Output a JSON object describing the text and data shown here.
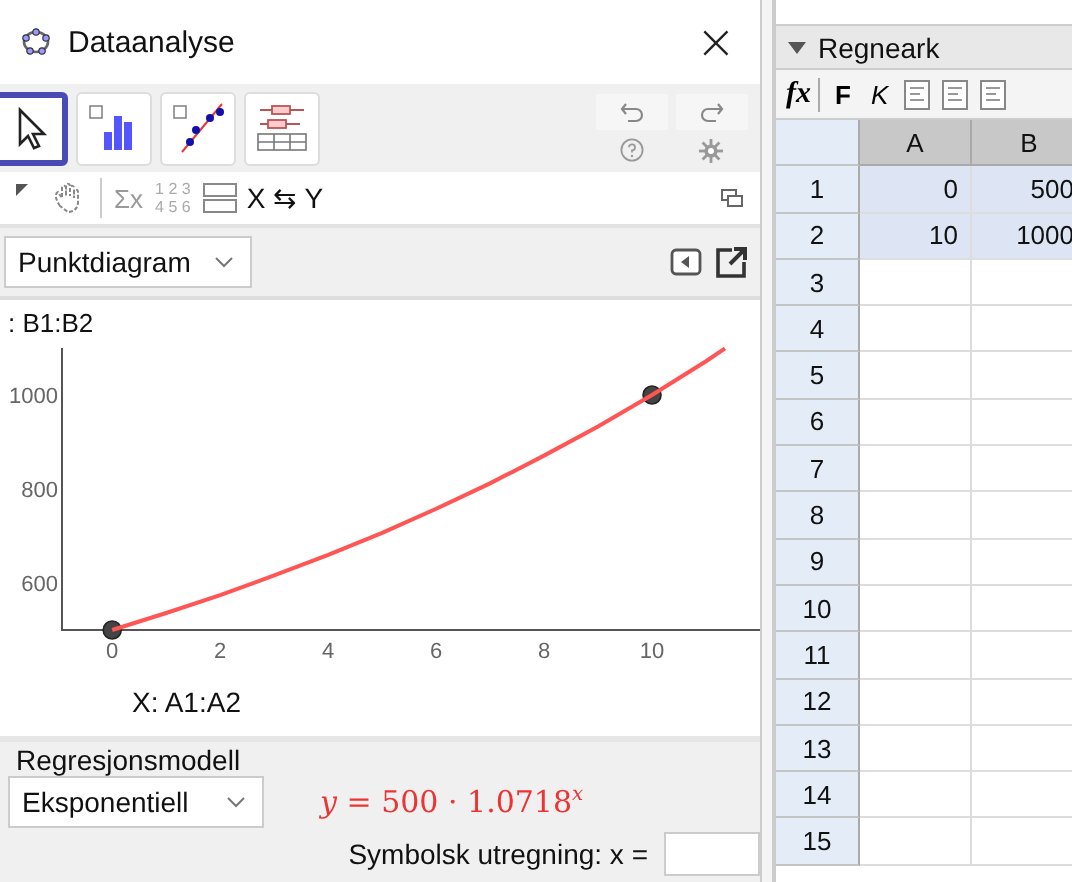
{
  "window": {
    "title": "Dataanalyse",
    "close": "×"
  },
  "tools": [
    {
      "kind": "pointer",
      "selected": true
    },
    {
      "kind": "histogram",
      "selected": false
    },
    {
      "kind": "scatter",
      "selected": false
    },
    {
      "kind": "boxplot",
      "selected": false
    }
  ],
  "swap_label": "X ⇆ Y",
  "sum_label": "Σx",
  "table_digits": [
    "1 2 3",
    "4 5 6"
  ],
  "plot_type": "Punktdiagram",
  "y_source": ":  B1:B2",
  "x_source": "X:  A1:A2",
  "chart_data": {
    "type": "scatter",
    "x": [
      0,
      1,
      2,
      3,
      4,
      5,
      6,
      7,
      8,
      9,
      10,
      11,
      11.35
    ],
    "series": [
      {
        "type": "scatter",
        "color": "#444444",
        "values": [
          500,
          null,
          null,
          null,
          null,
          null,
          null,
          null,
          null,
          null,
          1000,
          null,
          null
        ]
      },
      {
        "type": "line",
        "color": "#ff5555",
        "values": [
          500,
          536,
          574,
          616,
          660,
          707,
          758,
          812,
          871,
          933,
          1000,
          1072,
          1099
        ]
      }
    ],
    "xlim": [
      -0.93,
      12
    ],
    "ylim": [
      500,
      1100
    ],
    "xticks": [
      0,
      2,
      4,
      6,
      8,
      10
    ],
    "yticks": [
      600,
      800,
      1000
    ]
  },
  "regression": {
    "title": "Regresjonsmodell",
    "model": "Eksponentiell",
    "formula": "*y* = 500 · 1.0718$^{x}$",
    "symbolic_label": "Symbolsk utregning:  x ="
  },
  "sheet": {
    "title": "Regneark",
    "fx": "fx",
    "bold": "F",
    "italic": "K",
    "columns": [
      "A",
      "B"
    ],
    "rows": [
      {
        "label": "1",
        "cells": [
          "0",
          "500"
        ],
        "selected": true
      },
      {
        "label": "2",
        "cells": [
          "10",
          "1000"
        ],
        "selected": true
      },
      {
        "label": "3",
        "selected": false
      },
      {
        "label": "4",
        "selected": false
      },
      {
        "label": "5",
        "selected": false
      },
      {
        "label": "6",
        "selected": false
      },
      {
        "label": "7",
        "selected": false
      },
      {
        "label": "8",
        "selected": false
      },
      {
        "label": "9",
        "selected": false
      },
      {
        "label": "10",
        "selected": false
      },
      {
        "label": "11",
        "selected": false
      },
      {
        "label": "12",
        "selected": false
      },
      {
        "label": "13",
        "selected": false
      },
      {
        "label": "14",
        "selected": false
      },
      {
        "label": "15",
        "selected": false
      }
    ]
  }
}
